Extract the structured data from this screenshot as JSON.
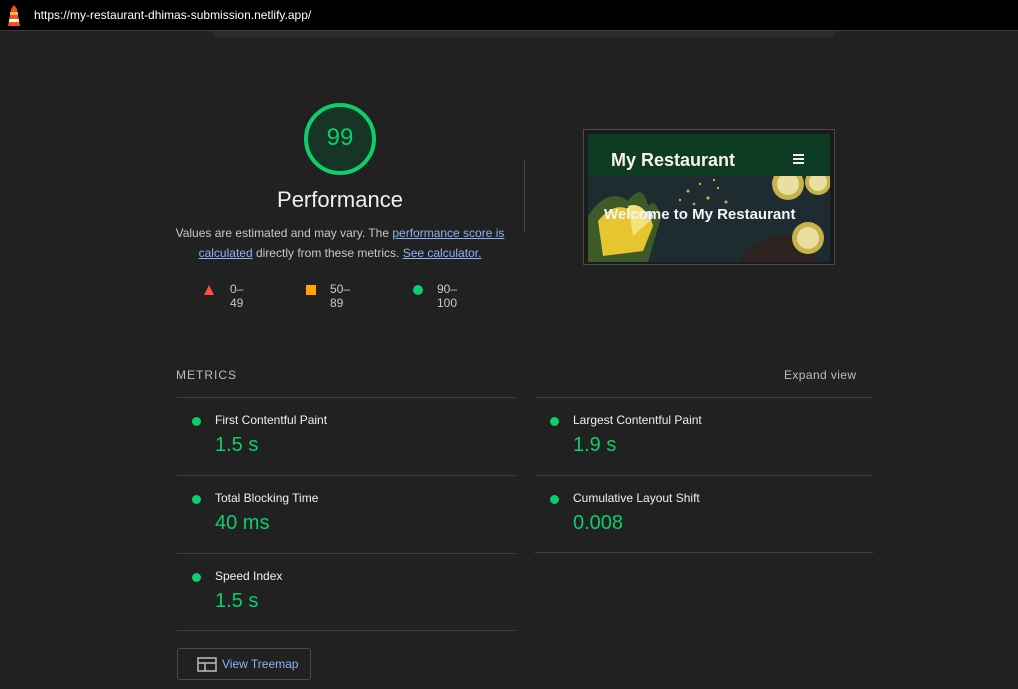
{
  "browser": {
    "url": "https://my-restaurant-dhimas-submission.netlify.app/",
    "icon": "lighthouse-icon"
  },
  "category": {
    "score": "99",
    "title": "Performance",
    "score_color": "#0cce6b",
    "description_prefix": "Values are estimated and may vary. The ",
    "description_link1": "performance score is calculated",
    "description_middle": " directly from these metrics. ",
    "description_link2": "See calculator."
  },
  "legend": [
    {
      "range": "0–49",
      "shape": "triangle",
      "color": "#ff4e42"
    },
    {
      "range": "50–89",
      "shape": "square",
      "color": "#ffa400"
    },
    {
      "range": "90–100",
      "shape": "circle",
      "color": "#0cce6b"
    }
  ],
  "thumbnail": {
    "brand": "My Restaurant",
    "hero_text": "Welcome to My Restaurant",
    "menu_icon": "hamburger-menu-icon"
  },
  "metrics": {
    "title": "METRICS",
    "expand_label": "Expand view",
    "items": [
      {
        "label": "First Contentful Paint",
        "value": "1.5 s"
      },
      {
        "label": "Largest Contentful Paint",
        "value": "1.9 s"
      },
      {
        "label": "Total Blocking Time",
        "value": "40 ms"
      },
      {
        "label": "Cumulative Layout Shift",
        "value": "0.008"
      },
      {
        "label": "Speed Index",
        "value": "1.5 s"
      }
    ]
  },
  "treemap": {
    "label": "View Treemap",
    "icon": "treemap-icon"
  }
}
